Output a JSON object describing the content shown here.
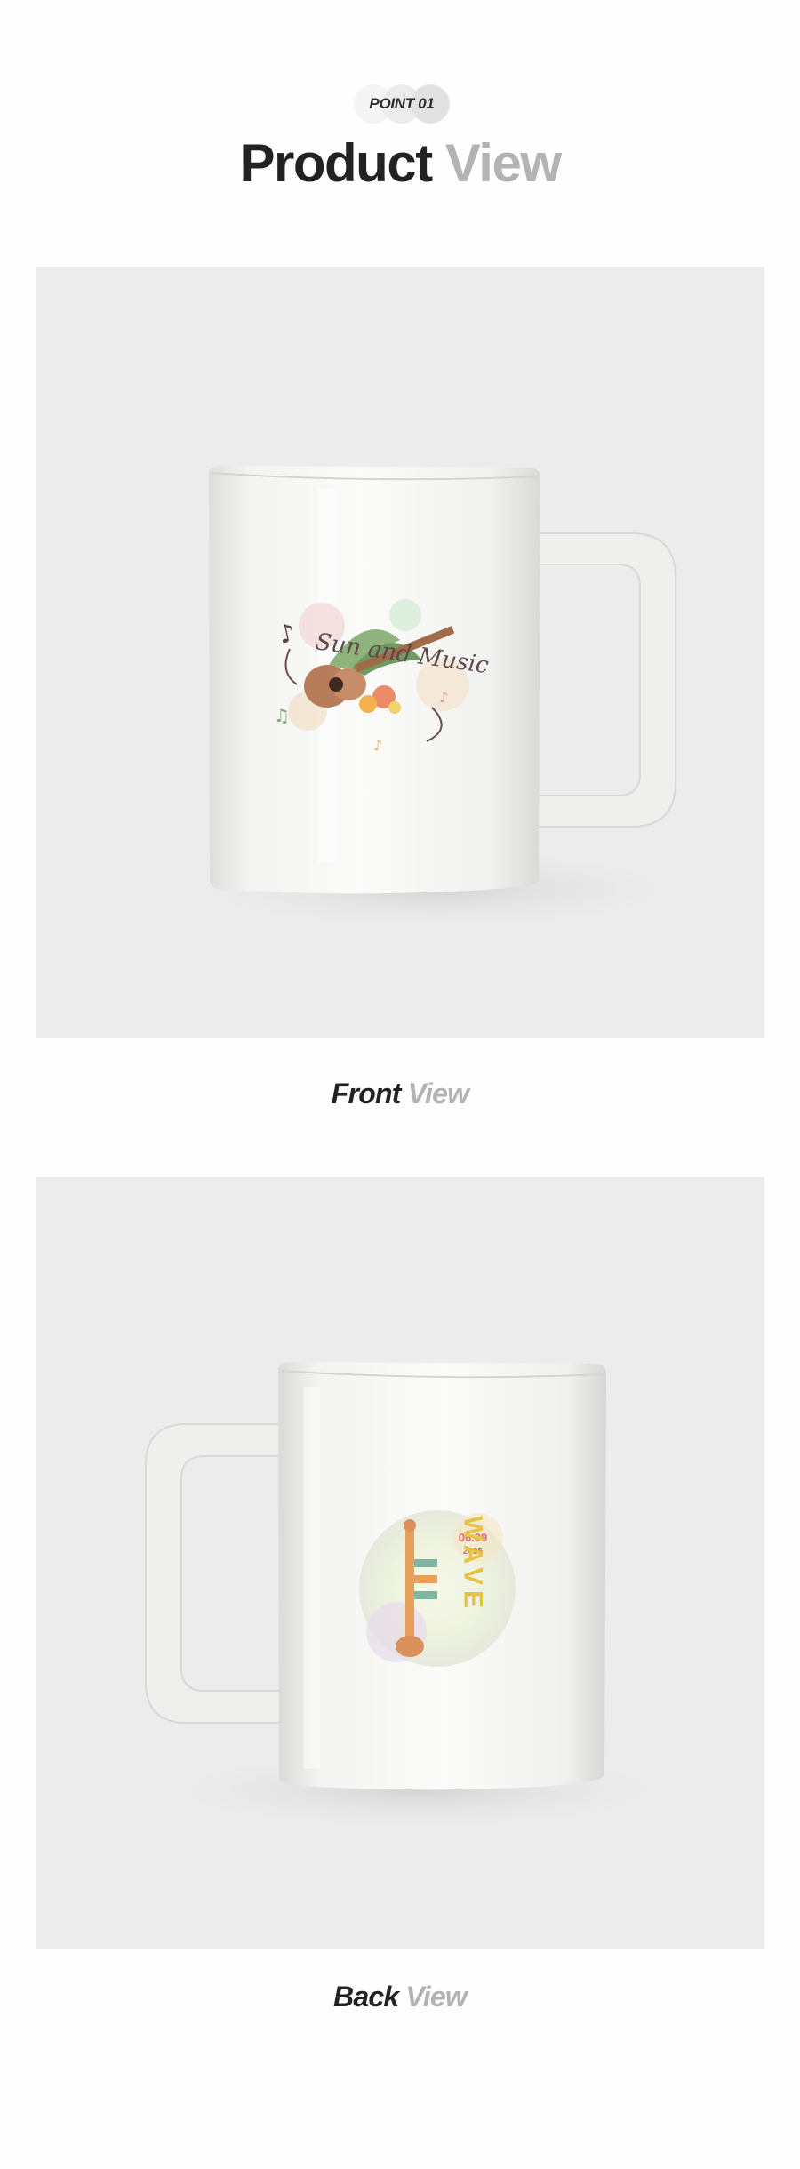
{
  "badge": {
    "label": "POINT 01"
  },
  "header": {
    "title_main": "Product",
    "title_accent": "View"
  },
  "front": {
    "caption_main": "Front",
    "caption_accent": "View",
    "print_text": "Sun and Music"
  },
  "back": {
    "caption_main": "Back",
    "caption_accent": "View",
    "print_date": "06.09",
    "print_year": "2025",
    "print_word": "WAVE"
  },
  "colors": {
    "background": "#fefefe",
    "photo_bg": "#ececec",
    "title_dark": "#222222",
    "title_light": "#b3b3b3",
    "mug_white": "#f7f7f5"
  }
}
